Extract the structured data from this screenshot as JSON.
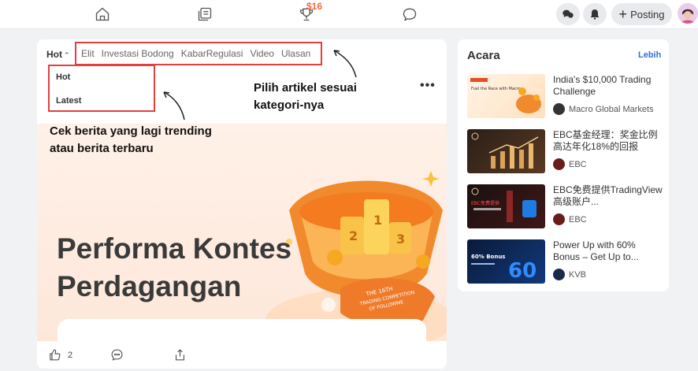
{
  "topbar": {
    "icons": [
      "home-icon",
      "feed-icon",
      "trophy-icon",
      "chat-icon",
      "community-icon",
      "bell-icon"
    ],
    "trophy_badge": "$16",
    "posting_label": "Posting"
  },
  "feed": {
    "hot_label": "Hot",
    "categories": [
      "Elit",
      "Investasi Bodong",
      "KabarRegulasi",
      "Video",
      "Ulasan"
    ],
    "dropdown": [
      "Hot",
      "Latest"
    ],
    "banner_title_line1": "Performa Kontes",
    "banner_title_line2": "Perdagangan",
    "banner_art_text": "THE 16TH TRADING COMPETITION OF FOLLOWME",
    "like_count": "2"
  },
  "annotations": {
    "category_note_line1": "Pilih artikel sesuai",
    "category_note_line2": "kategori-nya",
    "trending_note_line1": "Cek berita yang lagi trending",
    "trending_note_line2": "atau berita terbaru"
  },
  "panel": {
    "title": "Acara",
    "more": "Lebih",
    "events": [
      {
        "title": "India's $10,000 Trading Challenge",
        "source": "Macro Global Markets",
        "thumb_text": "Fuel the Race with Macro"
      },
      {
        "title": "EBC基金经理：奖金比例高达年化18%的回报",
        "source": "EBC",
        "thumb_text": ""
      },
      {
        "title": "EBC免费提供TradingView高级账户...",
        "source": "EBC",
        "thumb_text": "EBC免费提供"
      },
      {
        "title": "Power Up with 60% Bonus – Get Up to...",
        "source": "KVB",
        "thumb_text": "60% Bonus"
      }
    ]
  },
  "colors": {
    "highlight_box": "#e43f3f",
    "link": "#2f6fdc",
    "badge": "#f26a3d"
  }
}
